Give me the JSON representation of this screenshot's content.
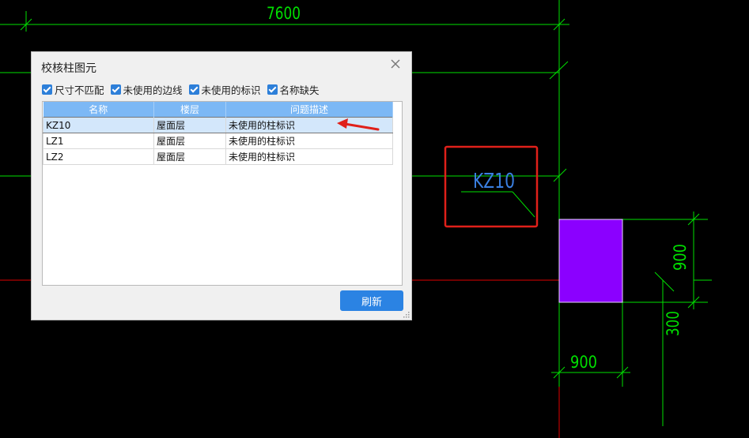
{
  "cad": {
    "dim_top": "7600",
    "column_label": "KZ10",
    "dim_bottom": "900",
    "dim_right_upper": "900",
    "dim_right_lower": "300"
  },
  "dialog": {
    "title": "校核柱图元",
    "close_icon": "close-icon",
    "checkboxes": [
      {
        "label": "尺寸不匹配",
        "checked": true
      },
      {
        "label": "未使用的边线",
        "checked": true
      },
      {
        "label": "未使用的标识",
        "checked": true
      },
      {
        "label": "名称缺失",
        "checked": true
      }
    ],
    "table": {
      "headers": [
        "名称",
        "楼层",
        "问题描述"
      ],
      "rows": [
        {
          "name": "KZ10",
          "floor": "屋面层",
          "issue": "未使用的柱标识",
          "selected": true
        },
        {
          "name": "LZ1",
          "floor": "屋面层",
          "issue": "未使用的柱标识",
          "selected": false
        },
        {
          "name": "LZ2",
          "floor": "屋面层",
          "issue": "未使用的柱标识",
          "selected": false
        }
      ]
    },
    "refresh_label": "刷新"
  },
  "colors": {
    "cad_green": "#00e000",
    "axis_red": "#e00000",
    "column_fill": "#8b00ff",
    "highlight_red": "#e0201a",
    "label_blue": "#3a7fe0",
    "button_blue": "#2b83e3"
  }
}
